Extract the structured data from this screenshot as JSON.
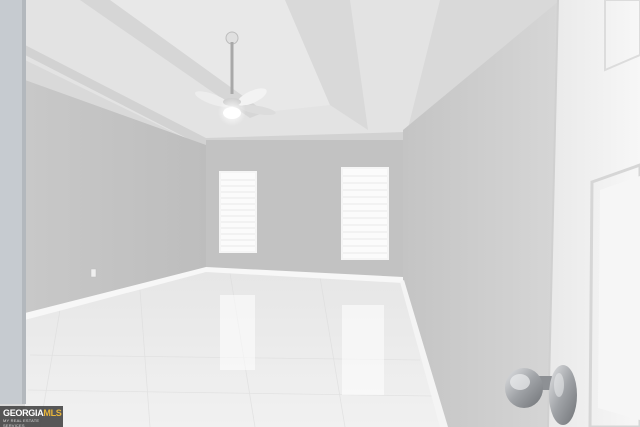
{
  "watermark": {
    "brand_left": "GEORGIA",
    "brand_right": "MLS",
    "tagline": "MY REAL ESTATE SERVICES"
  },
  "colors": {
    "wall": "#c9c9c9",
    "ceiling": "#e6e6e6",
    "floor": "#eeeeee",
    "door": "#f2f2f2",
    "baseboard": "#f7f7f7",
    "knob": "#a5a7aa"
  },
  "icons": [
    "ceiling-fan-icon",
    "door-knob-icon",
    "window-blinds-icon"
  ]
}
